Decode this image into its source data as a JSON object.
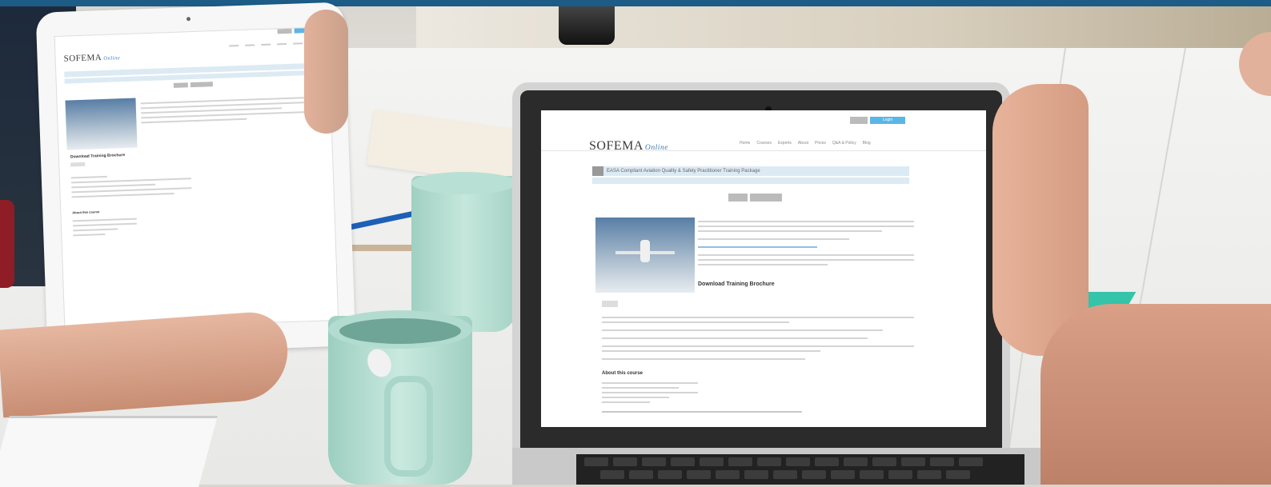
{
  "tablet_page": {
    "logo": "SOFEMA",
    "logo_sub": "Online",
    "heading": "Download Training Brochure",
    "section": "About this course"
  },
  "laptop_page": {
    "logo": "SOFEMA",
    "logo_sub": "Online",
    "nav": [
      "Home",
      "Courses",
      "Experts",
      "About",
      "Prices",
      "Q&A & Policy",
      "Blog"
    ],
    "top_buttons": [
      "",
      "Login"
    ],
    "course_title": "EASA Compliant Aviation Quality & Safety Practitioner Training Package",
    "heading_brochure": "Download Training Brochure",
    "heading_about": "About this course"
  },
  "colors": {
    "topbar": "#1c5c86",
    "accent_blue": "#5ab6e6",
    "cup_mint": "#b9e0d4"
  }
}
